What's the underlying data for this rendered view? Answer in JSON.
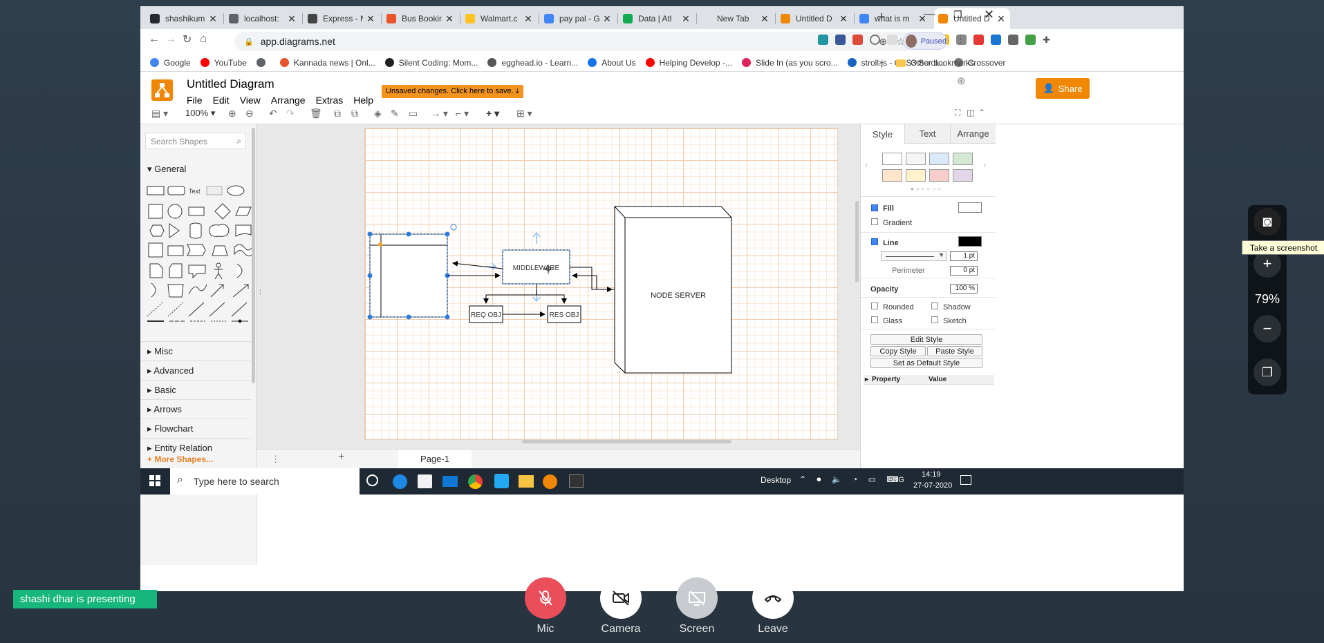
{
  "browser": {
    "tabs": [
      {
        "label": "shashikum",
        "color": "#24292e"
      },
      {
        "label": "localhost:",
        "color": "#5f6368"
      },
      {
        "label": "Express - N",
        "color": "#444444"
      },
      {
        "label": "Bus Bookin",
        "color": "#e8542c"
      },
      {
        "label": "Walmart.c",
        "color": "#ffc220"
      },
      {
        "label": "pay pal - G",
        "color": "#4285f4"
      },
      {
        "label": "Data | Atl",
        "color": "#13aa52"
      },
      {
        "label": "New Tab",
        "color": "#dee1e6"
      },
      {
        "label": "Untitled D",
        "color": "#f08705"
      },
      {
        "label": "what is m",
        "color": "#4285f4"
      },
      {
        "label": "Untitled D",
        "color": "#f08705"
      }
    ],
    "url": "app.diagrams.net",
    "paused_label": "Paused",
    "bookmarks": [
      {
        "label": "Google",
        "color": "#4285f4"
      },
      {
        "label": "YouTube",
        "color": "#ff0000"
      },
      {
        "label": "",
        "color": "#5f6368"
      },
      {
        "label": "Kannada news | Onl...",
        "color": "#e8542c"
      },
      {
        "label": "Silent Coding: Mom...",
        "color": "#222222"
      },
      {
        "label": "egghead.io - Learn...",
        "color": "#555555"
      },
      {
        "label": "About Us",
        "color": "#1a73e8"
      },
      {
        "label": "Helping Develop -...",
        "color": "#ff0000"
      },
      {
        "label": "Slide In (as you scro...",
        "color": "#e0245e"
      },
      {
        "label": "stroll.js - CSS3 Scrol...",
        "color": "#1565c0"
      },
      {
        "label": "Crossover",
        "color": "#777777"
      }
    ],
    "other_bookmarks": "Other bookmarks"
  },
  "drawio": {
    "title": "Untitled Diagram",
    "menu": [
      "File",
      "Edit",
      "View",
      "Arrange",
      "Extras",
      "Help"
    ],
    "unsaved": "Unsaved changes. Click here to save.",
    "share": "Share",
    "zoom": "100%",
    "search_placeholder": "Search Shapes",
    "sections": [
      "General",
      "Misc",
      "Advanced",
      "Basic",
      "Arrows",
      "Flowchart",
      "Entity Relation"
    ],
    "more_shapes": "+ More Shapes...",
    "shape_text": "Text",
    "page_tab": "Page-1",
    "diagram": {
      "middleware": "MIDDLEWARE",
      "node_server": "NODE SERVER",
      "req": "REQ OBJ",
      "res": "RES OBJ"
    },
    "format": {
      "tabs": [
        "Style",
        "Text",
        "Arrange"
      ],
      "fill": "Fill",
      "gradient": "Gradient",
      "line": "Line",
      "line_width": "1 pt",
      "perimeter": "Perimeter",
      "perimeter_value": "0 pt",
      "opacity": "Opacity",
      "opacity_value": "100 %",
      "rounded": "Rounded",
      "shadow": "Shadow",
      "glass": "Glass",
      "sketch": "Sketch",
      "edit_style": "Edit Style",
      "copy_style": "Copy Style",
      "paste_style": "Paste Style",
      "default_style": "Set as Default Style",
      "property": "Property",
      "value": "Value",
      "swatches": [
        "#ffffff",
        "#f5f5f5",
        "#dae8fc",
        "#d5e8d4",
        "#ffe6cc",
        "#fff2cc",
        "#f8cecc",
        "#e1d5e7"
      ]
    }
  },
  "taskbar": {
    "search": "Type here to search",
    "desktop": "Desktop",
    "lang": "ENG",
    "time": "14:19",
    "date": "27-07-2020"
  },
  "meeting": {
    "tooltip": "Take a screenshot",
    "zoom": "79%",
    "presenting": "shashi dhar is presenting",
    "mic": "Mic",
    "camera": "Camera",
    "screen": "Screen",
    "leave": "Leave"
  }
}
